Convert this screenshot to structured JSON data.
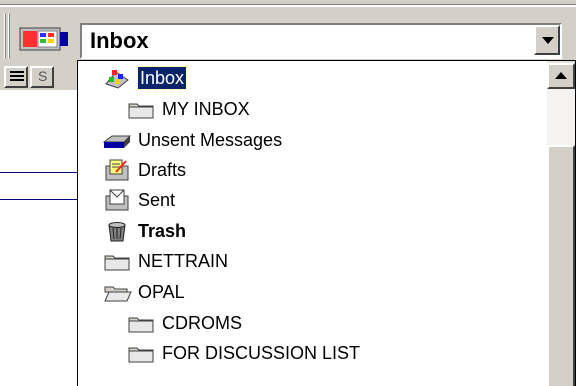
{
  "combo": {
    "selected_value": "Inbox"
  },
  "left_pane": {
    "button2_label": "S"
  },
  "folders": [
    {
      "label": "Inbox",
      "icon": "inbox-icon",
      "selected": true
    },
    {
      "label": "MY INBOX",
      "icon": "folder-icon"
    },
    {
      "label": "Unsent Messages",
      "icon": "unsent-messages-icon"
    },
    {
      "label": "Drafts",
      "icon": "drafts-icon"
    },
    {
      "label": "Sent",
      "icon": "sent-icon"
    },
    {
      "label": "Trash",
      "icon": "trash-icon",
      "bold": true
    },
    {
      "label": "NETTRAIN",
      "icon": "folder-icon"
    },
    {
      "label": "OPAL",
      "icon": "open-folder-icon"
    },
    {
      "label": "CDROMS",
      "icon": "folder-icon"
    },
    {
      "label": "FOR DISCUSSION LIST",
      "icon": "folder-icon"
    }
  ],
  "colors": {
    "selection": "#0a246a",
    "chrome": "#d4d0c8"
  }
}
